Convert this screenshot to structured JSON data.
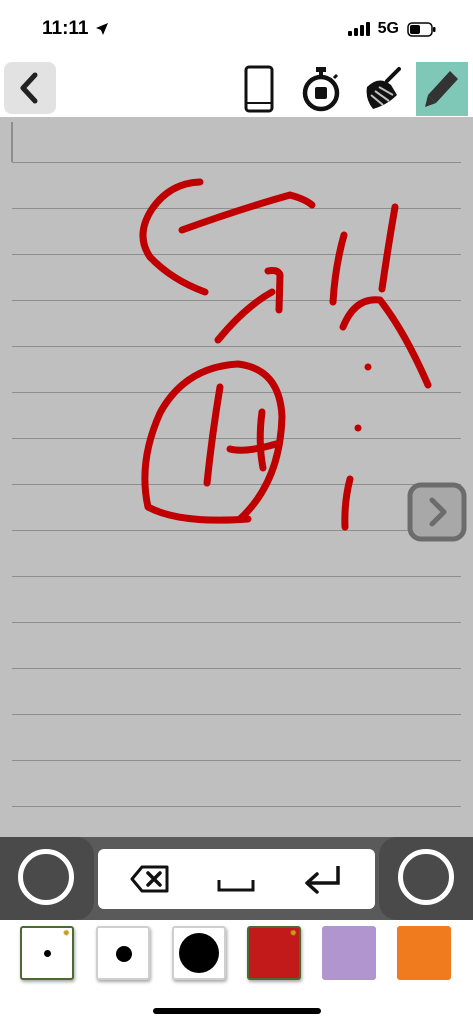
{
  "status_bar": {
    "time": "11:11",
    "network": "5G",
    "location_icon": "location-arrow-icon",
    "signal_icon": "cellular-signal-icon",
    "battery_icon": "battery-icon"
  },
  "toolbar": {
    "back_icon": "chevron-left-icon",
    "tools": [
      {
        "name": "phone-icon",
        "active": false
      },
      {
        "name": "stopwatch-icon",
        "active": false
      },
      {
        "name": "broom-icon",
        "active": false
      },
      {
        "name": "pencil-icon",
        "active": true
      }
    ],
    "active_color": "#7fc7b6"
  },
  "page": {
    "background": "#bfbfbf",
    "rule_color": "#8e8e8e",
    "ink_color": "#c00000",
    "next_icon": "chevron-right-icon"
  },
  "keyboard_bar": {
    "left_button": "circle-button",
    "right_button": "circle-button",
    "keys": [
      "delete-key-icon",
      "space-key-icon",
      "return-key-icon"
    ]
  },
  "palette": {
    "pens": [
      {
        "name": "small-pen",
        "size": "small",
        "selected": true
      },
      {
        "name": "medium-pen",
        "size": "medium",
        "selected": false
      },
      {
        "name": "large-pen",
        "size": "large",
        "selected": false
      }
    ],
    "colors": [
      {
        "name": "red",
        "hex": "#c21a1a",
        "selected": true
      },
      {
        "name": "lavender",
        "hex": "#b095cf",
        "selected": false
      },
      {
        "name": "orange",
        "hex": "#f07a1e",
        "selected": false
      }
    ]
  }
}
